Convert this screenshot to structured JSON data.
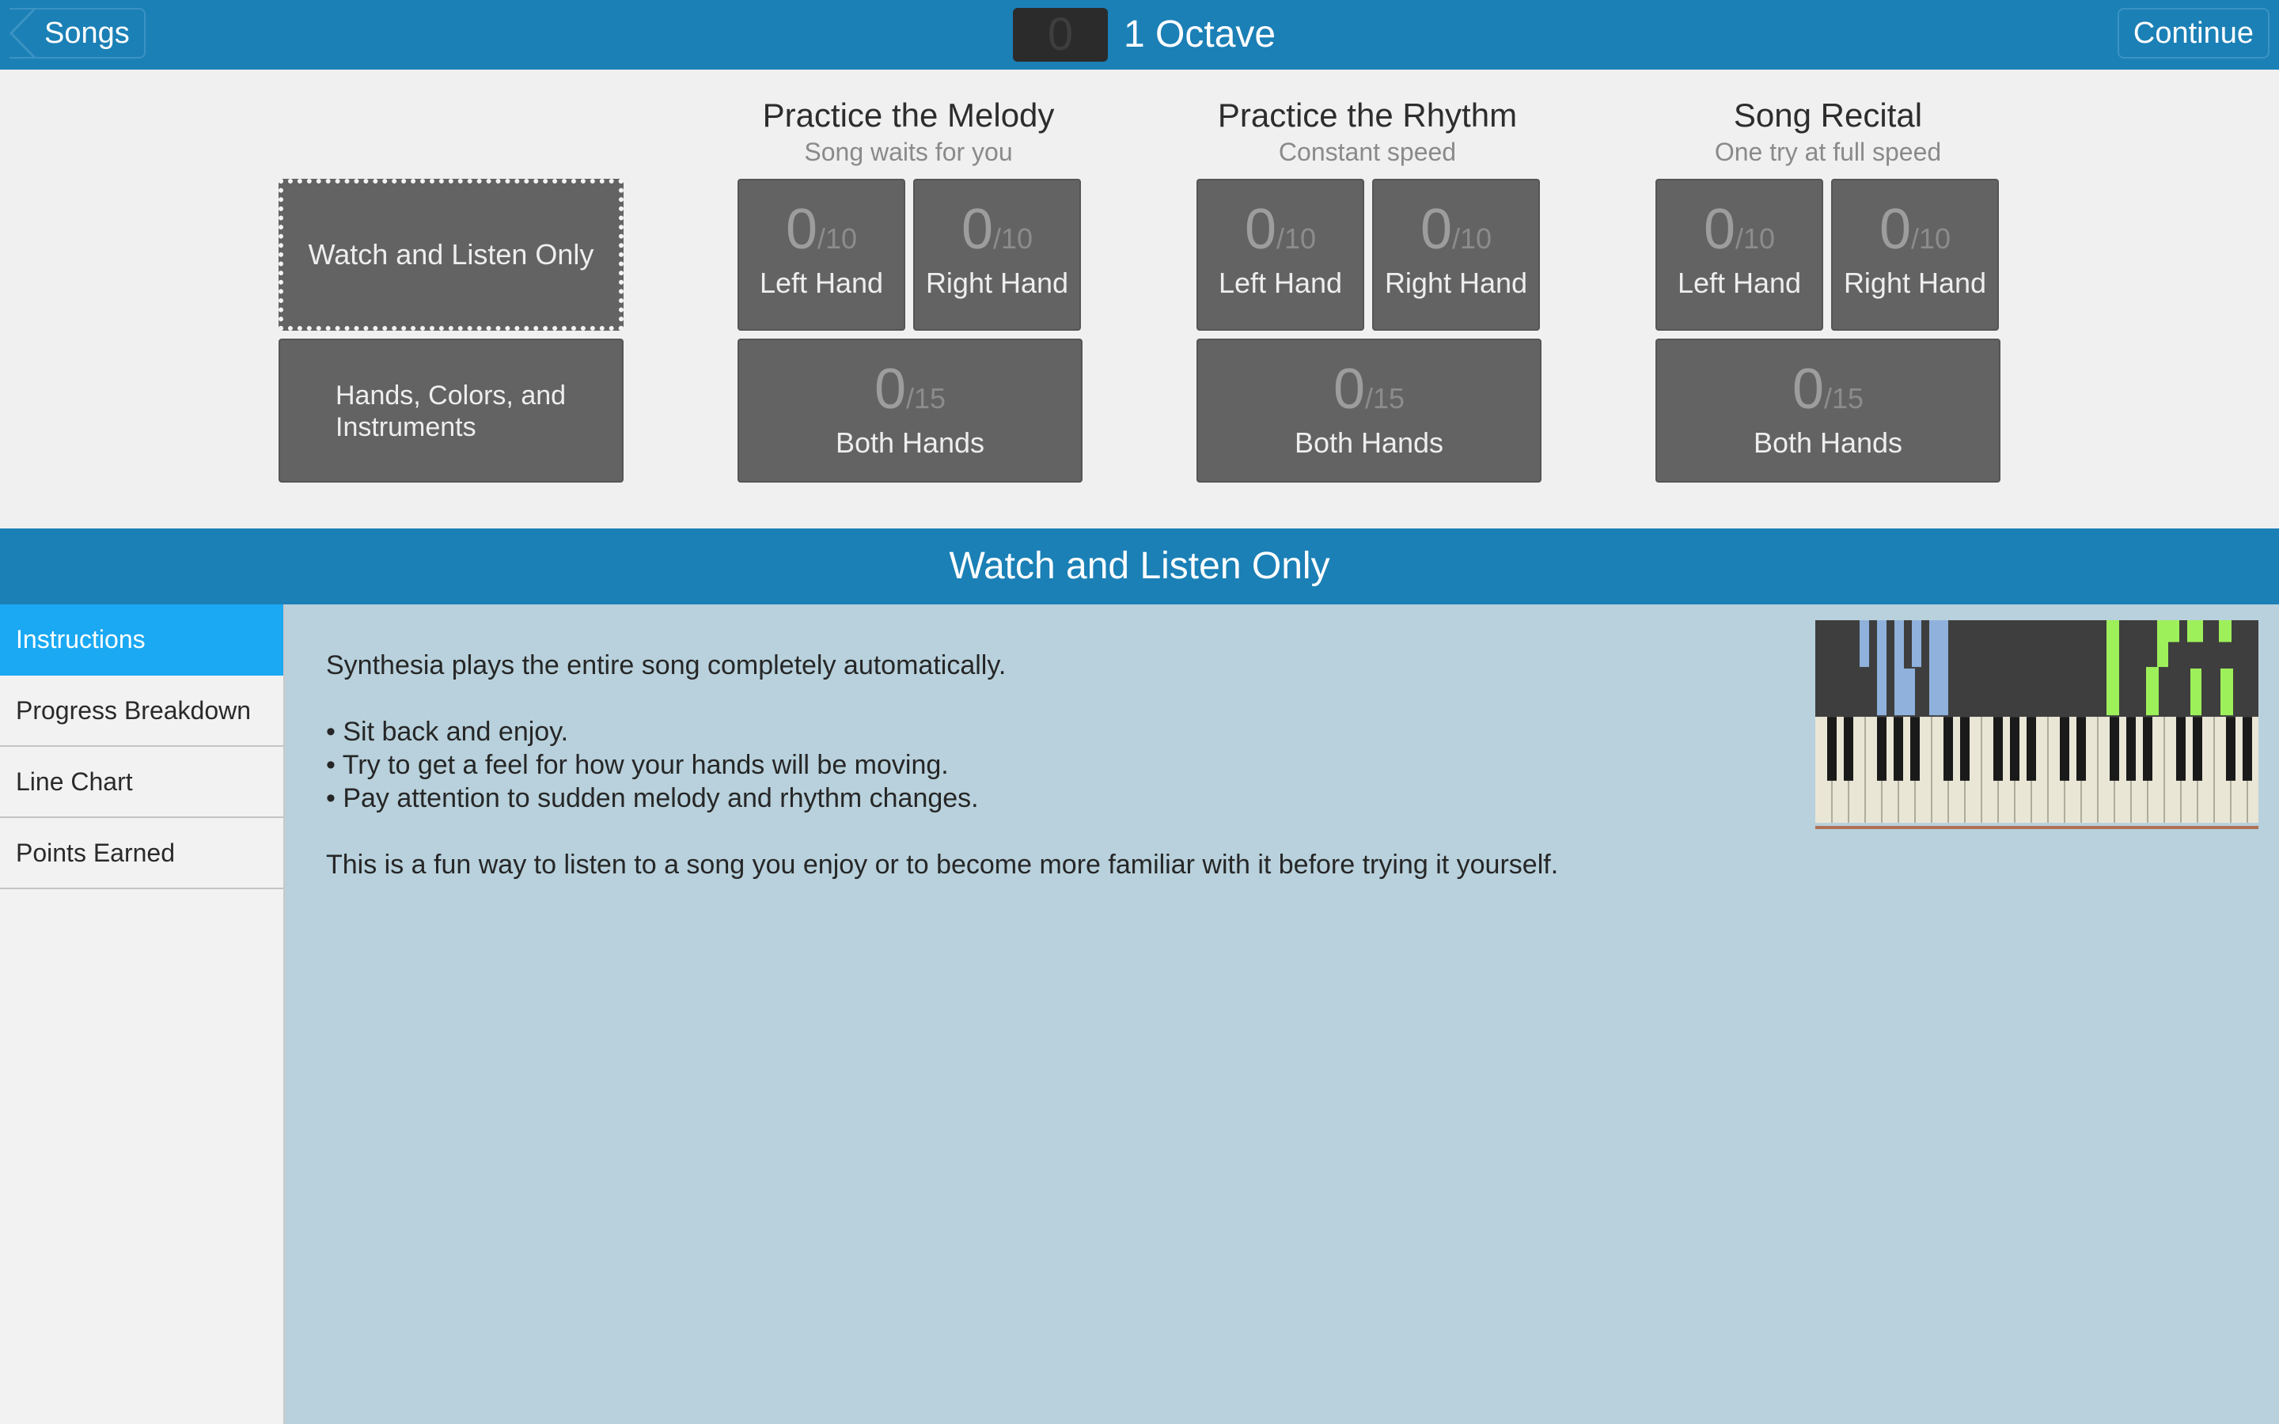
{
  "topbar": {
    "back_label": "Songs",
    "octave_count": "0",
    "title": "1 Octave",
    "continue_label": "Continue"
  },
  "modes": {
    "watch": {
      "label": "Watch and Listen Only"
    },
    "options": {
      "label_line1": "Hands, Colors, and",
      "label_line2": "Instruments"
    },
    "melody": {
      "title": "Practice the Melody",
      "subtitle": "Song waits for you",
      "left": {
        "score": "0",
        "denom": "/10",
        "label": "Left Hand"
      },
      "right": {
        "score": "0",
        "denom": "/10",
        "label": "Right Hand"
      },
      "both": {
        "score": "0",
        "denom": "/15",
        "label": "Both Hands"
      }
    },
    "rhythm": {
      "title": "Practice the Rhythm",
      "subtitle": "Constant speed",
      "left": {
        "score": "0",
        "denom": "/10",
        "label": "Left Hand"
      },
      "right": {
        "score": "0",
        "denom": "/10",
        "label": "Right Hand"
      },
      "both": {
        "score": "0",
        "denom": "/15",
        "label": "Both Hands"
      }
    },
    "recital": {
      "title": "Song Recital",
      "subtitle": "One try at full speed",
      "left": {
        "score": "0",
        "denom": "/10",
        "label": "Left Hand"
      },
      "right": {
        "score": "0",
        "denom": "/10",
        "label": "Right Hand"
      },
      "both": {
        "score": "0",
        "denom": "/15",
        "label": "Both Hands"
      }
    }
  },
  "section": {
    "title": "Watch and Listen Only"
  },
  "sidebar": {
    "items": [
      "Instructions",
      "Progress Breakdown",
      "Line Chart",
      "Points Earned"
    ],
    "active": "Instructions"
  },
  "content": {
    "intro": "Synthesia plays the entire song completely automatically.",
    "bullets": [
      "• Sit back and enjoy.",
      "• Try to get a feel for how your hands will be moving.",
      "• Pay attention to sudden melody and rhythm changes."
    ],
    "outro": "This is a fun way to listen to a song you enjoy or to become more familiar with it before trying it yourself."
  },
  "colors": {
    "topbar": "#1b80b6",
    "active_tab": "#1ba9f3",
    "content_bg": "#b8d1dc",
    "tile": "#636363",
    "note_blue": "#8fb1dc",
    "note_green": "#9ef05a"
  }
}
